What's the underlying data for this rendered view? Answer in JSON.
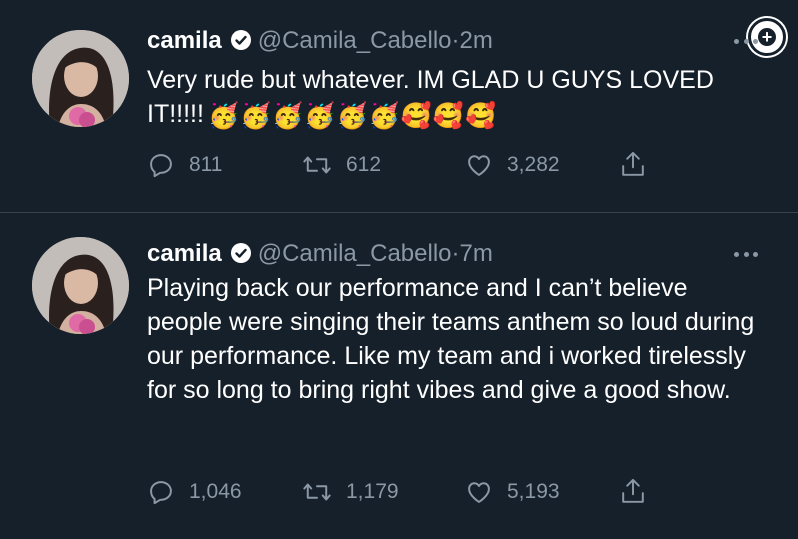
{
  "tweets": [
    {
      "name": "camila",
      "handle": "@Camila_Cabello",
      "dot": "·",
      "time": "2m",
      "text": "Very rude but whatever. IM GLAD U GUYS LOVED IT!!!!!",
      "emojis": "🥳🥳🥳🥳🥳🥳🥰🥰🥰",
      "replies": "811",
      "retweets": "612",
      "likes": "3,282"
    },
    {
      "name": "camila",
      "handle": "@Camila_Cabello",
      "dot": "·",
      "time": "7m",
      "text": "Playing back our performance and I can’t believe people were singing their teams anthem so loud during our performance. Like my team and i worked tirelessly for so long to bring right vibes and give a good show.",
      "replies": "1,046",
      "retweets": "1,179",
      "likes": "5,193"
    }
  ],
  "icons": {
    "verified": "verified-badge-icon",
    "reply": "reply-icon",
    "retweet": "retweet-icon",
    "like": "heart-icon",
    "share": "share-icon",
    "more": "more-icon",
    "plus": "plus-icon"
  },
  "colors": {
    "background": "#15202b",
    "text": "#ffffff",
    "secondary": "#8b98a5",
    "divider": "#38444d"
  }
}
